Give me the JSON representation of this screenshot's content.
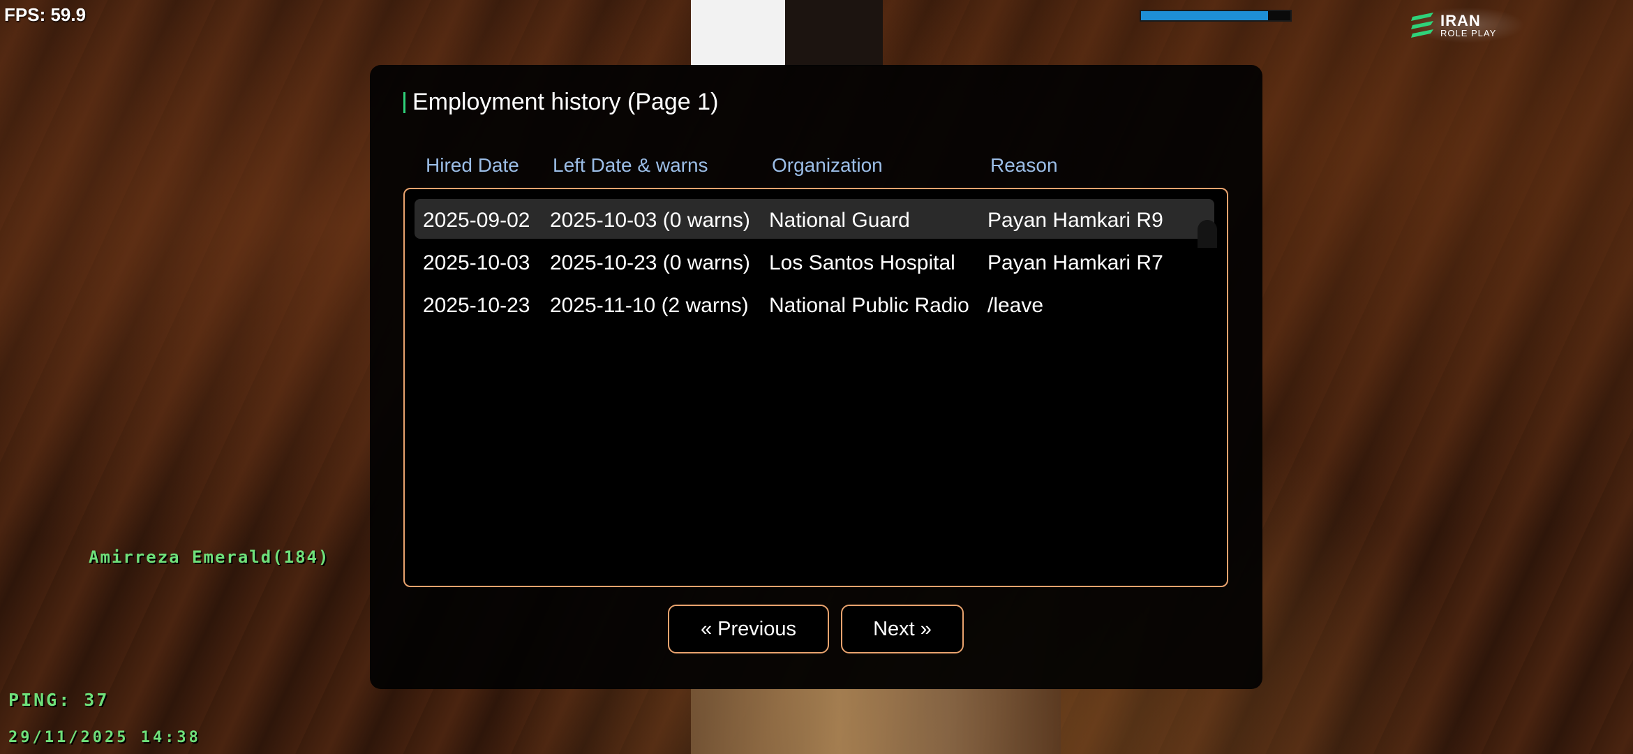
{
  "hud": {
    "fps": "FPS: 59.9",
    "health_bar_fill": 0.85,
    "health_bar_color": "#1e8fd6",
    "logo_line1": "IRAN",
    "logo_line2": "ROLE PLAY",
    "player_name": "Amirreza Emerald(184)",
    "ping": "PING: 37",
    "datetime": "29/11/2025 14:38"
  },
  "dialog": {
    "title": "Employment history (Page 1)",
    "accent_color": "#2fd37a",
    "border_color": "#e9a36e",
    "columns": [
      "Hired Date",
      "Left Date & warns",
      "Organization",
      "Reason"
    ],
    "rows": [
      {
        "hired": "2025-09-02",
        "left": "2025-10-03 (0 warns)",
        "organization": "National Guard",
        "reason": "Payan Hamkari R9",
        "selected": true
      },
      {
        "hired": "2025-10-03",
        "left": "2025-10-23 (0 warns)",
        "organization": "Los Santos Hospital",
        "reason": "Payan Hamkari R7",
        "selected": false
      },
      {
        "hired": "2025-10-23",
        "left": "2025-11-10 (2 warns)",
        "organization": "National Public Radio",
        "reason": "/leave",
        "selected": false
      }
    ],
    "previous_label": "« Previous",
    "next_label": "Next »"
  }
}
